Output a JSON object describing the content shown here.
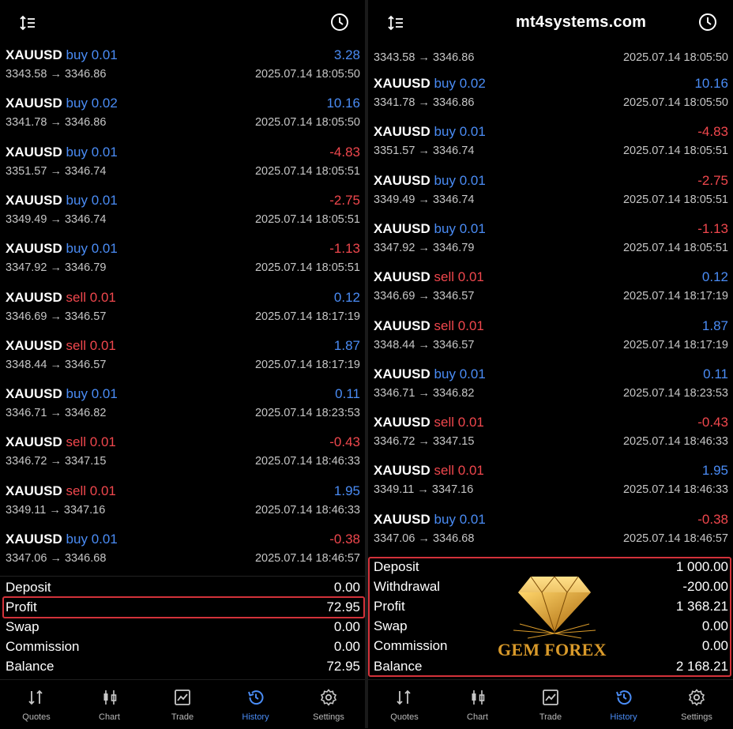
{
  "watermark": "mt4systems.com",
  "colors": {
    "buy": "#4a8cf5",
    "sell": "#f0474d",
    "highlight": "#d2323a",
    "gold": "#d99a2a"
  },
  "left": {
    "deals": [
      {
        "symbol": "XAUUSD",
        "dir": "buy",
        "lot": "0.01",
        "profit": "3.28",
        "prices": "3343.58 → 3346.86",
        "time": "2025.07.14 18:05:50"
      },
      {
        "symbol": "XAUUSD",
        "dir": "buy",
        "lot": "0.02",
        "profit": "10.16",
        "prices": "3341.78 → 3346.86",
        "time": "2025.07.14 18:05:50"
      },
      {
        "symbol": "XAUUSD",
        "dir": "buy",
        "lot": "0.01",
        "profit": "-4.83",
        "prices": "3351.57 → 3346.74",
        "time": "2025.07.14 18:05:51"
      },
      {
        "symbol": "XAUUSD",
        "dir": "buy",
        "lot": "0.01",
        "profit": "-2.75",
        "prices": "3349.49 → 3346.74",
        "time": "2025.07.14 18:05:51"
      },
      {
        "symbol": "XAUUSD",
        "dir": "buy",
        "lot": "0.01",
        "profit": "-1.13",
        "prices": "3347.92 → 3346.79",
        "time": "2025.07.14 18:05:51"
      },
      {
        "symbol": "XAUUSD",
        "dir": "sell",
        "lot": "0.01",
        "profit": "0.12",
        "prices": "3346.69 → 3346.57",
        "time": "2025.07.14 18:17:19"
      },
      {
        "symbol": "XAUUSD",
        "dir": "sell",
        "lot": "0.01",
        "profit": "1.87",
        "prices": "3348.44 → 3346.57",
        "time": "2025.07.14 18:17:19"
      },
      {
        "symbol": "XAUUSD",
        "dir": "buy",
        "lot": "0.01",
        "profit": "0.11",
        "prices": "3346.71 → 3346.82",
        "time": "2025.07.14 18:23:53"
      },
      {
        "symbol": "XAUUSD",
        "dir": "sell",
        "lot": "0.01",
        "profit": "-0.43",
        "prices": "3346.72 → 3347.15",
        "time": "2025.07.14 18:46:33"
      },
      {
        "symbol": "XAUUSD",
        "dir": "sell",
        "lot": "0.01",
        "profit": "1.95",
        "prices": "3349.11 → 3347.16",
        "time": "2025.07.14 18:46:33"
      },
      {
        "symbol": "XAUUSD",
        "dir": "buy",
        "lot": "0.01",
        "profit": "-0.38",
        "prices": "3347.06 → 3346.68",
        "time": "2025.07.14 18:46:57"
      }
    ],
    "summary": [
      {
        "label": "Deposit",
        "value": "0.00"
      },
      {
        "label": "Profit",
        "value": "72.95"
      },
      {
        "label": "Swap",
        "value": "0.00"
      },
      {
        "label": "Commission",
        "value": "0.00"
      },
      {
        "label": "Balance",
        "value": "72.95"
      }
    ]
  },
  "right": {
    "partial": {
      "prices": "3343.58 → 3346.86",
      "time": "2025.07.14 18:05:50"
    },
    "deals": [
      {
        "symbol": "XAUUSD",
        "dir": "buy",
        "lot": "0.02",
        "profit": "10.16",
        "prices": "3341.78 → 3346.86",
        "time": "2025.07.14 18:05:50"
      },
      {
        "symbol": "XAUUSD",
        "dir": "buy",
        "lot": "0.01",
        "profit": "-4.83",
        "prices": "3351.57 → 3346.74",
        "time": "2025.07.14 18:05:51"
      },
      {
        "symbol": "XAUUSD",
        "dir": "buy",
        "lot": "0.01",
        "profit": "-2.75",
        "prices": "3349.49 → 3346.74",
        "time": "2025.07.14 18:05:51"
      },
      {
        "symbol": "XAUUSD",
        "dir": "buy",
        "lot": "0.01",
        "profit": "-1.13",
        "prices": "3347.92 → 3346.79",
        "time": "2025.07.14 18:05:51"
      },
      {
        "symbol": "XAUUSD",
        "dir": "sell",
        "lot": "0.01",
        "profit": "0.12",
        "prices": "3346.69 → 3346.57",
        "time": "2025.07.14 18:17:19"
      },
      {
        "symbol": "XAUUSD",
        "dir": "sell",
        "lot": "0.01",
        "profit": "1.87",
        "prices": "3348.44 → 3346.57",
        "time": "2025.07.14 18:17:19"
      },
      {
        "symbol": "XAUUSD",
        "dir": "buy",
        "lot": "0.01",
        "profit": "0.11",
        "prices": "3346.71 → 3346.82",
        "time": "2025.07.14 18:23:53"
      },
      {
        "symbol": "XAUUSD",
        "dir": "sell",
        "lot": "0.01",
        "profit": "-0.43",
        "prices": "3346.72 → 3347.15",
        "time": "2025.07.14 18:46:33"
      },
      {
        "symbol": "XAUUSD",
        "dir": "sell",
        "lot": "0.01",
        "profit": "1.95",
        "prices": "3349.11 → 3347.16",
        "time": "2025.07.14 18:46:33"
      },
      {
        "symbol": "XAUUSD",
        "dir": "buy",
        "lot": "0.01",
        "profit": "-0.38",
        "prices": "3347.06 → 3346.68",
        "time": "2025.07.14 18:46:57"
      }
    ],
    "summary": [
      {
        "label": "Deposit",
        "value": "1 000.00"
      },
      {
        "label": "Withdrawal",
        "value": "-200.00"
      },
      {
        "label": "Profit",
        "value": "1 368.21"
      },
      {
        "label": "Swap",
        "value": "0.00"
      },
      {
        "label": "Commission",
        "value": "0.00"
      },
      {
        "label": "Balance",
        "value": "2 168.21"
      }
    ]
  },
  "logo": {
    "text": "GEM FOREX"
  },
  "nav": [
    {
      "label": "Quotes",
      "icon": "quotes-icon",
      "active": false
    },
    {
      "label": "Chart",
      "icon": "chart-icon",
      "active": false
    },
    {
      "label": "Trade",
      "icon": "trade-icon",
      "active": false
    },
    {
      "label": "History",
      "icon": "history-icon",
      "active": true
    },
    {
      "label": "Settings",
      "icon": "settings-icon",
      "active": false
    }
  ]
}
